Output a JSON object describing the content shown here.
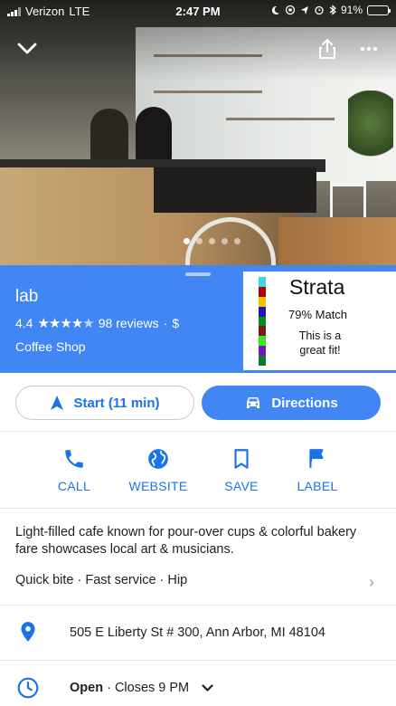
{
  "status_bar": {
    "carrier": "Verizon",
    "network": "LTE",
    "time": "2:47 PM",
    "battery": "91%",
    "battery_level": 0.91
  },
  "hero": {
    "photo_count": 5,
    "active_photo_index": 0
  },
  "place": {
    "name": "lab",
    "rating": "4.4",
    "stars_filled": 4.4,
    "reviews": "98 reviews",
    "price_sep": "·",
    "price": "$",
    "category": "Coffee Shop"
  },
  "strata": {
    "title": "Strata",
    "match": "79% Match",
    "fit_line1": "This is a",
    "fit_line2": "great fit!",
    "bar_colors": [
      "#3ad7e8",
      "#b30000",
      "#f2c200",
      "#1a1ab8",
      "#0a8a1a",
      "#7a1a1a",
      "#39e61a",
      "#6a1ab8",
      "#0f7a2a"
    ]
  },
  "actions": {
    "start_label": "Start (11 min)",
    "directions_label": "Directions"
  },
  "quick_actions": [
    {
      "label": "CALL"
    },
    {
      "label": "WEBSITE"
    },
    {
      "label": "SAVE"
    },
    {
      "label": "LABEL"
    }
  ],
  "description": "Light-filled cafe known for pour-over cups & colorful bakery fare showcases local art & musicians.",
  "tags": "Quick bite · Fast service · Hip",
  "address": "505 E Liberty St # 300, Ann Arbor, MI 48104",
  "hours": {
    "status": "Open",
    "detail": " · Closes 9 PM"
  },
  "colors": {
    "accent": "#4286f4",
    "link": "#1a73e8"
  }
}
